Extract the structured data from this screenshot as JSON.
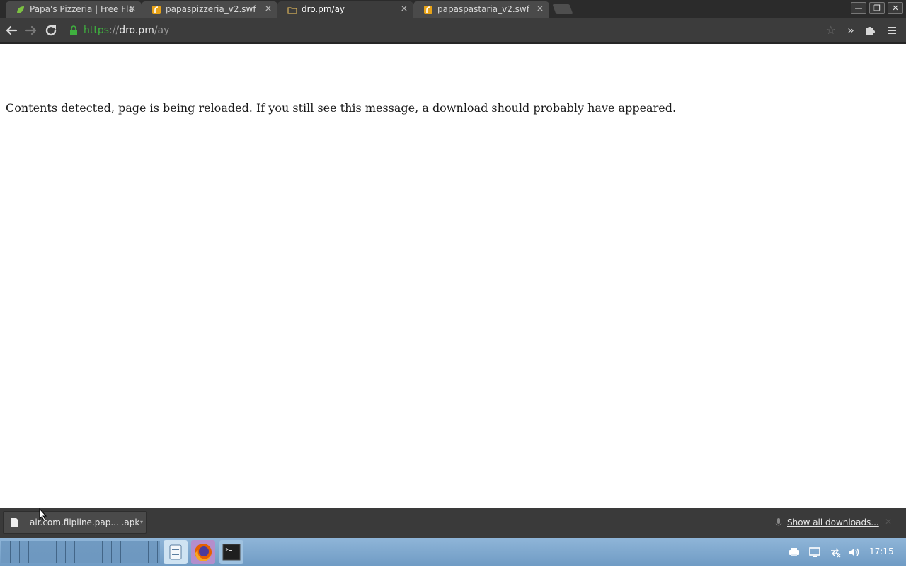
{
  "tabs": [
    {
      "title": "Papa's Pizzeria | Free Fla",
      "favicon": "leaf-favicon-icon",
      "active": false
    },
    {
      "title": "papaspizzeria_v2.swf",
      "favicon": "flash-favicon-icon",
      "active": false
    },
    {
      "title": "dro.pm/ay",
      "favicon": "folder-favicon-icon",
      "active": true
    },
    {
      "title": "papaspastaria_v2.swf",
      "favicon": "flash-favicon-icon",
      "active": false
    }
  ],
  "tab_close_glyph": "×",
  "window_controls": {
    "minimize": "—",
    "restore": "❐",
    "close": "✕"
  },
  "address_bar": {
    "scheme": "https",
    "separator": "://",
    "host": "dro.pm",
    "path": "/ay",
    "secure": true
  },
  "page": {
    "message": "Contents detected, page is being reloaded. If you still see this message, a download should probably have appeared."
  },
  "downloads": {
    "item_name": "air.com.flipline.pap... .apk",
    "show_all_label": "Show all downloads..."
  },
  "taskbar": {
    "launchers": [
      "files-icon",
      "firefox-icon",
      "terminal-icon"
    ],
    "clock": "17:15"
  },
  "colors": {
    "tab_strip": "#2b2b2b",
    "toolbar": "#3c3c3c",
    "secure_scheme": "#3fb03f",
    "taskbar": "#7ea9d0"
  }
}
